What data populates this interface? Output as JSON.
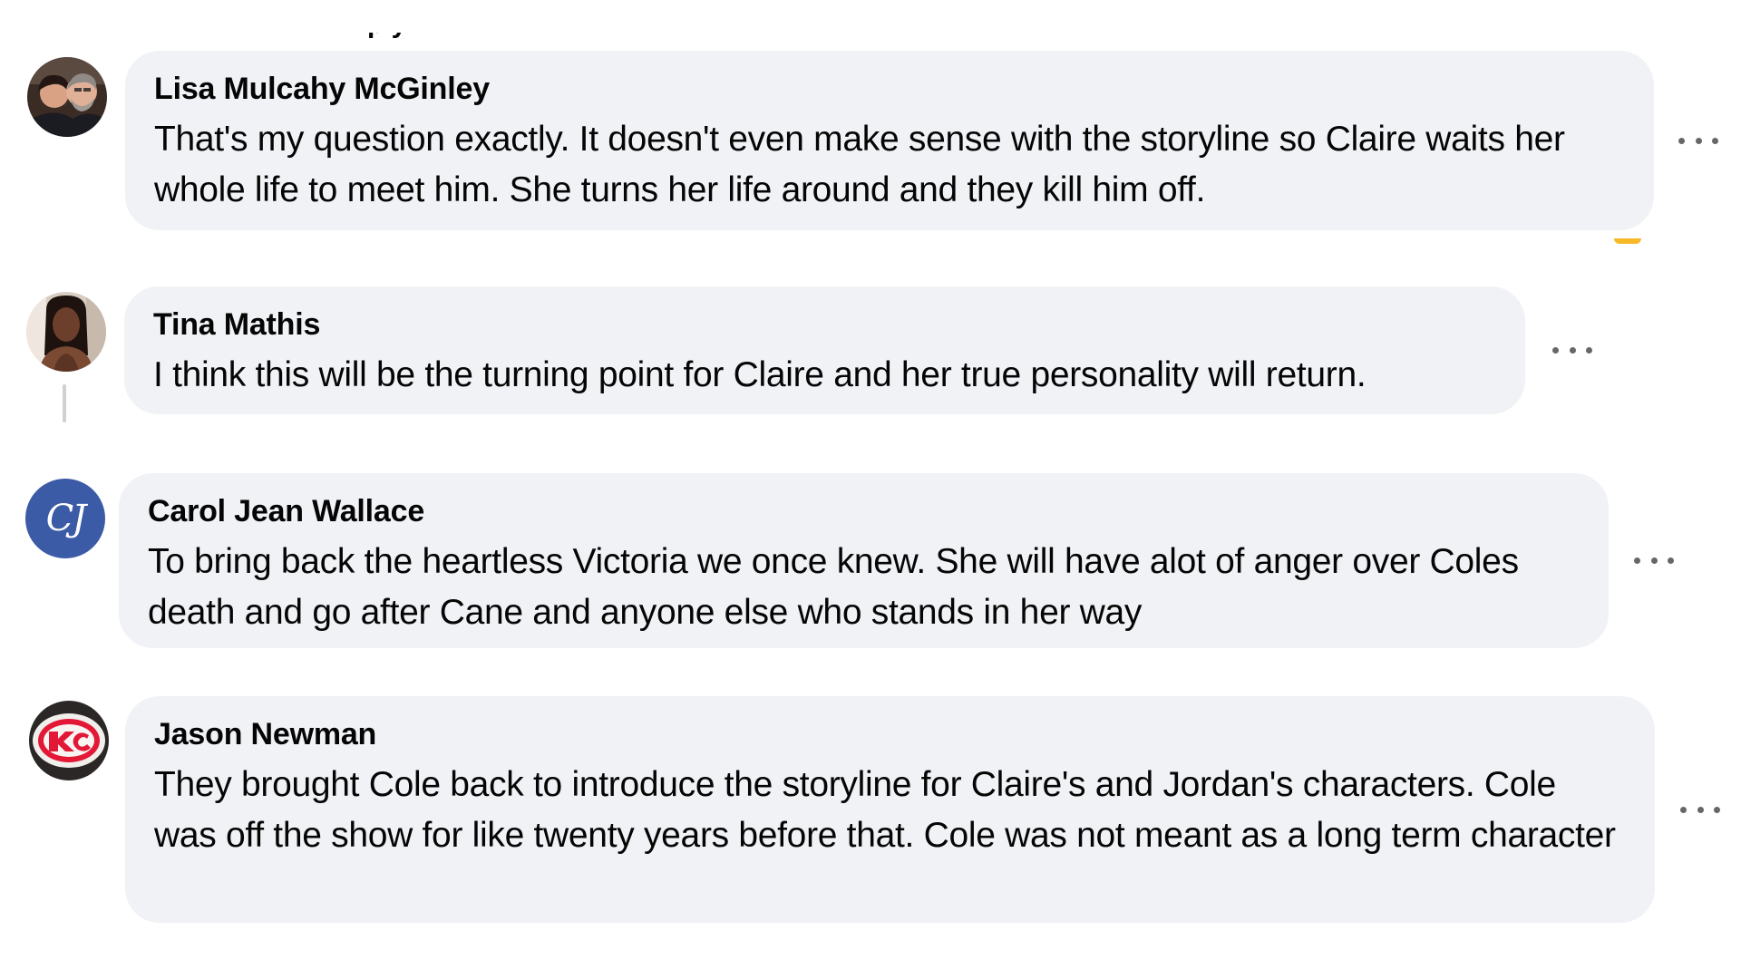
{
  "comments": [
    {
      "author": "Lisa Mulcahy McGinley",
      "text": "That's my question exactly. It doesn't even make sense with the storyline so Claire waits her whole life to meet him. She turns her life around and they kill him off.",
      "avatar": "profile-photo"
    },
    {
      "author": "Tina Mathis",
      "text": "I think this will be the turning point for Claire and her true personality will return.",
      "avatar": "profile-photo"
    },
    {
      "author": "Carol Jean Wallace",
      "text": "To bring back the heartless Victoria we once knew. She will have alot of anger over Coles death and go after Cane and anyone else who stands in her way",
      "avatar": "monogram",
      "initials": "CJ"
    },
    {
      "author": "Jason Newman",
      "text": "They brought Cole back to introduce the storyline for Claire's and Jordan's characters. Cole was off the show for like twenty years before that. Cole was not meant as a long term character",
      "avatar": "team-logo"
    }
  ],
  "colors": {
    "bubble": "#f0f2f5",
    "text": "#050505",
    "icon": "#65676b",
    "monogram_bg": "#3b5ba7",
    "thread_line": "#ced0d4"
  },
  "icons": {
    "more": "more-options-icon"
  }
}
